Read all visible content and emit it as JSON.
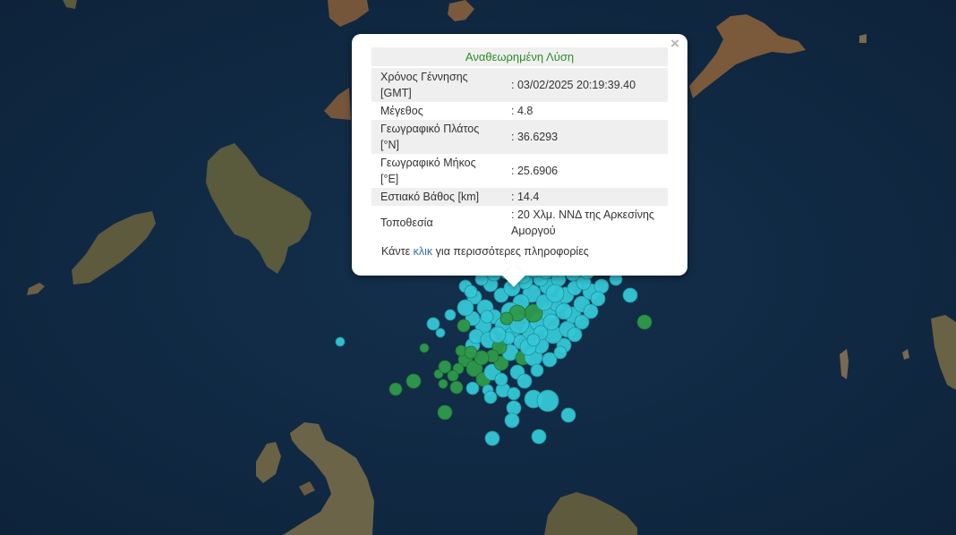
{
  "popup": {
    "header": "Αναθεωρημένη Λύση",
    "rows": [
      {
        "label": "Χρόνος Γέννησης [GMT]",
        "value": "03/02/2025 20:19:39.40"
      },
      {
        "label": "Μέγεθος",
        "value": "4.8"
      },
      {
        "label": "Γεωγραφικό Πλάτος [°N]",
        "value": "36.6293"
      },
      {
        "label": "Γεωγραφικό Μήκος [°E]",
        "value": "25.6906"
      },
      {
        "label": "Εστιακό Βάθος [km]",
        "value": "14.4"
      },
      {
        "label": "Τοποθεσία",
        "value": "20 Χλμ. ΝΝΔ της Αρκεσίνης Αμοργού"
      }
    ],
    "more_prefix": "Κάντε",
    "more_link": "κλικ",
    "more_suffix": "για περισσότερες πληροφορίες",
    "close_icon": "close-icon"
  },
  "map": {
    "sea_color": "#0f2a44",
    "land_color": "#5d5740",
    "event_colors": {
      "recent": "#35c7d6",
      "older": "#2e9a4c"
    }
  }
}
